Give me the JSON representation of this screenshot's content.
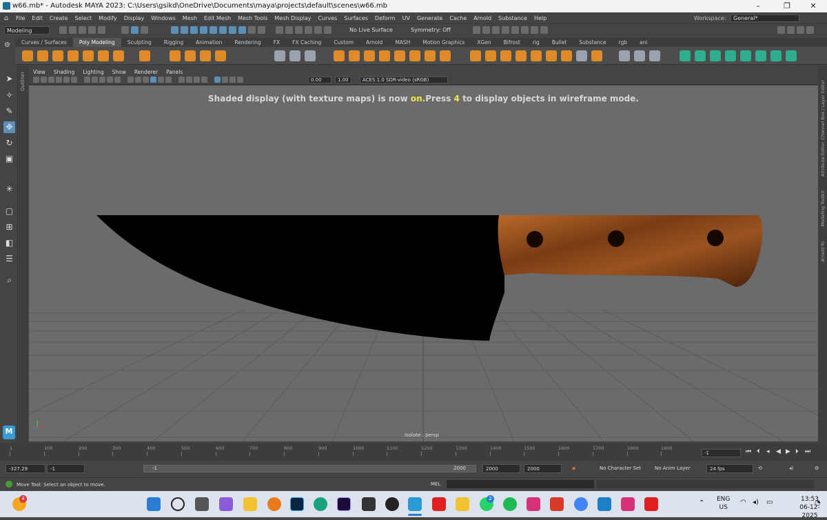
{
  "window": {
    "title": "w66.mb* - Autodesk MAYA 2023: C:\\Users\\gsikd\\OneDrive\\Documents\\maya\\projects\\default\\scenes\\w66.mb",
    "controls": [
      "–",
      "❐",
      "✕"
    ]
  },
  "menubar": {
    "items": [
      "File",
      "Edit",
      "Create",
      "Select",
      "Modify",
      "Display",
      "Windows",
      "Mesh",
      "Edit Mesh",
      "Mesh Tools",
      "Mesh Display",
      "Curves",
      "Surfaces",
      "Deform",
      "UV",
      "Generate",
      "Cache",
      "Arnold",
      "Substance",
      "Help"
    ],
    "workspace_label": "Workspace:",
    "workspace_value": "General*"
  },
  "statusline": {
    "mode": "Modeling",
    "live_surface": "No Live Surface",
    "symmetry": "Symmetry: Off"
  },
  "shelf": {
    "tabs": [
      "Curves / Surfaces",
      "Poly Modeling",
      "Sculpting",
      "Rigging",
      "Animation",
      "Rendering",
      "FX",
      "FX Caching",
      "Custom",
      "Arnold",
      "MASH",
      "Motion Graphics",
      "XGen",
      "Bifrost",
      "rig",
      "Bullet",
      "Substance",
      "rgb",
      "ani"
    ],
    "active_tab": "Poly Modeling"
  },
  "panel": {
    "menus": [
      "View",
      "Shading",
      "Lighting",
      "Show",
      "Renderer",
      "Panels"
    ],
    "exposure": "0.00",
    "gamma": "1.00",
    "color_space": "ACES 1.0 SDR-video (sRGB)"
  },
  "viewport": {
    "hud_part1": "Shaded display (with texture maps) is now ",
    "hud_on": "on.",
    "hud_part2": "Press ",
    "hud_key": "4",
    "hud_part3": " to display objects in wireframe mode.",
    "camera_label": "Isolate : persp",
    "left_strip": "Outliner",
    "right_strip": [
      "Channel Box / Layer Editor",
      "Attribute Editor",
      "Modeling Toolkit",
      "Arnold RI"
    ]
  },
  "timeslider": {
    "ticks": [
      "1",
      "100",
      "200",
      "300",
      "400",
      "500",
      "600",
      "700",
      "800",
      "900",
      "1000",
      "1100",
      "1200",
      "1300",
      "1400",
      "1500",
      "1600",
      "1700",
      "1800",
      "1900"
    ],
    "current_frame": "-1",
    "start_marker": "1"
  },
  "rangeslider": {
    "field1": "-327.29",
    "field2": "-1",
    "range_start": "-1",
    "range_end": "2000",
    "anim_end": "2000",
    "anim_end2": "2000",
    "character_set": "No Character Set",
    "anim_layer": "No Anim Layer",
    "fps": "24 fps"
  },
  "cmdline": {
    "help": "Move Tool: Select an object to move.",
    "lang": "MEL"
  },
  "taskbar": {
    "notification_badge": "4",
    "whatsapp_badge": "2",
    "lang_top": "ENG",
    "lang_bottom": "US",
    "time": "13:53",
    "date": "06-12-2025"
  },
  "colors": {
    "viewport_bg": "#6b6b6b",
    "hud_highlight": "#f2e64a",
    "blade": "#000000",
    "handle": "#6a3512",
    "accent": "#5d8fbd"
  }
}
